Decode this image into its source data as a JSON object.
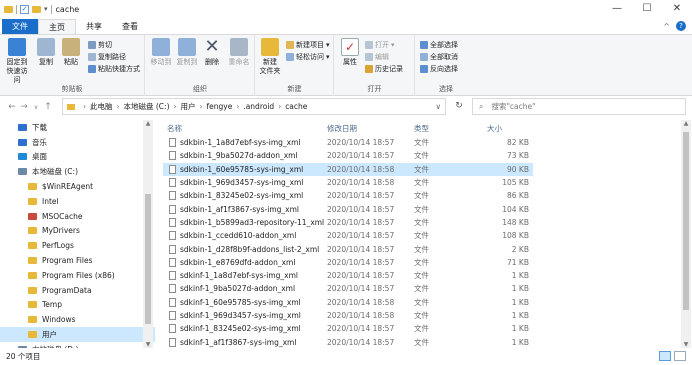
{
  "window": {
    "title": "cache",
    "controls": [
      "—",
      "☐",
      "✕"
    ]
  },
  "ribbon_tabs": [
    "文件",
    "主页",
    "共享",
    "查看"
  ],
  "ribbon": {
    "clipboard": {
      "pin": "固定到\n快速访问",
      "copy": "复制",
      "paste": "粘贴",
      "cut": "剪切",
      "copy_path": "复制路径",
      "paste_shortcut": "粘贴快捷方式",
      "label": "剪贴板"
    },
    "organize": {
      "move_to": "移动到",
      "copy_to": "复制到",
      "delete": "删除",
      "rename": "重命名",
      "label": "组织"
    },
    "new": {
      "new_folder": "新建\n文件夹",
      "new_item": "新建项目",
      "easy_access": "轻松访问",
      "label": "新建"
    },
    "open": {
      "properties": "属性",
      "open": "打开",
      "edit": "编辑",
      "history": "历史记录",
      "label": "打开"
    },
    "select": {
      "select_all": "全部选择",
      "select_none": "全部取消",
      "invert": "反向选择",
      "label": "选择"
    }
  },
  "address": {
    "crumbs": [
      "此电脑",
      "本地磁盘 (C:)",
      "用户",
      "fengye",
      ".android",
      "cache"
    ]
  },
  "search": {
    "placeholder": "搜索\"cache\""
  },
  "sidebar": {
    "items": [
      {
        "label": "下载",
        "icon": "download-icon",
        "color": "#2f6fd0"
      },
      {
        "label": "音乐",
        "icon": "music-icon",
        "color": "#2f6fd0"
      },
      {
        "label": "桌面",
        "icon": "desktop-icon",
        "color": "#1f8ad8"
      },
      {
        "label": "本地磁盘 (C:)",
        "icon": "drive-icon",
        "color": "#6c8aa8"
      },
      {
        "label": "$WinREAgent",
        "icon": "folder-icon",
        "color": "#e8b83a"
      },
      {
        "label": "Intel",
        "icon": "folder-icon",
        "color": "#e8b83a"
      },
      {
        "label": "MSOCache",
        "icon": "folder-icon",
        "color": "#c84a3a"
      },
      {
        "label": "MyDrivers",
        "icon": "folder-icon",
        "color": "#e8b83a"
      },
      {
        "label": "PerfLogs",
        "icon": "folder-icon",
        "color": "#e8b83a"
      },
      {
        "label": "Program Files",
        "icon": "folder-icon",
        "color": "#e8b83a"
      },
      {
        "label": "Program Files (x86)",
        "icon": "folder-icon",
        "color": "#e8b83a"
      },
      {
        "label": "ProgramData",
        "icon": "folder-icon",
        "color": "#e8b83a"
      },
      {
        "label": "Temp",
        "icon": "folder-icon",
        "color": "#e8b83a"
      },
      {
        "label": "Windows",
        "icon": "folder-icon",
        "color": "#e8b83a"
      },
      {
        "label": "用户",
        "icon": "folder-icon",
        "color": "#e8b83a",
        "selected": true
      },
      {
        "label": "本地磁盘 (D:)",
        "icon": "drive-icon",
        "color": "#6c8aa8"
      }
    ]
  },
  "columns": {
    "name": "名称",
    "date": "修改日期",
    "type": "类型",
    "size": "大小"
  },
  "files": [
    {
      "name": "sdkbin-1_1a8d7ebf-sys-img_xml",
      "date": "2020/10/14 18:57",
      "type": "文件",
      "size": "82 KB"
    },
    {
      "name": "sdkbin-1_9ba5027d-addon_xml",
      "date": "2020/10/14 18:57",
      "type": "文件",
      "size": "73 KB"
    },
    {
      "name": "sdkbin-1_60e95785-sys-img_xml",
      "date": "2020/10/14 18:58",
      "type": "文件",
      "size": "90 KB",
      "selected": true
    },
    {
      "name": "sdkbin-1_969d3457-sys-img_xml",
      "date": "2020/10/14 18:58",
      "type": "文件",
      "size": "105 KB"
    },
    {
      "name": "sdkbin-1_83245e02-sys-img_xml",
      "date": "2020/10/14 18:57",
      "type": "文件",
      "size": "86 KB"
    },
    {
      "name": "sdkbin-1_af1f3867-sys-img_xml",
      "date": "2020/10/14 18:57",
      "type": "文件",
      "size": "104 KB"
    },
    {
      "name": "sdkbin-1_b5899ad3-repository-11_xml",
      "date": "2020/10/14 18:57",
      "type": "文件",
      "size": "148 KB"
    },
    {
      "name": "sdkbin-1_ccedd610-addon_xml",
      "date": "2020/10/14 18:57",
      "type": "文件",
      "size": "108 KB"
    },
    {
      "name": "sdkbin-1_d28f8b9f-addons_list-2_xml",
      "date": "2020/10/14 18:57",
      "type": "文件",
      "size": "2 KB"
    },
    {
      "name": "sdkbin-1_e8769dfd-addon_xml",
      "date": "2020/10/14 18:57",
      "type": "文件",
      "size": "71 KB"
    },
    {
      "name": "sdkinf-1_1a8d7ebf-sys-img_xml",
      "date": "2020/10/14 18:57",
      "type": "文件",
      "size": "1 KB"
    },
    {
      "name": "sdkinf-1_9ba5027d-addon_xml",
      "date": "2020/10/14 18:57",
      "type": "文件",
      "size": "1 KB"
    },
    {
      "name": "sdkinf-1_60e95785-sys-img_xml",
      "date": "2020/10/14 18:58",
      "type": "文件",
      "size": "1 KB"
    },
    {
      "name": "sdkinf-1_969d3457-sys-img_xml",
      "date": "2020/10/14 18:58",
      "type": "文件",
      "size": "1 KB"
    },
    {
      "name": "sdkinf-1_83245e02-sys-img_xml",
      "date": "2020/10/14 18:57",
      "type": "文件",
      "size": "1 KB"
    },
    {
      "name": "sdkinf-1_af1f3867-sys-img_xml",
      "date": "2020/10/14 18:57",
      "type": "文件",
      "size": "1 KB"
    }
  ],
  "status": {
    "count": "20 个项目"
  }
}
